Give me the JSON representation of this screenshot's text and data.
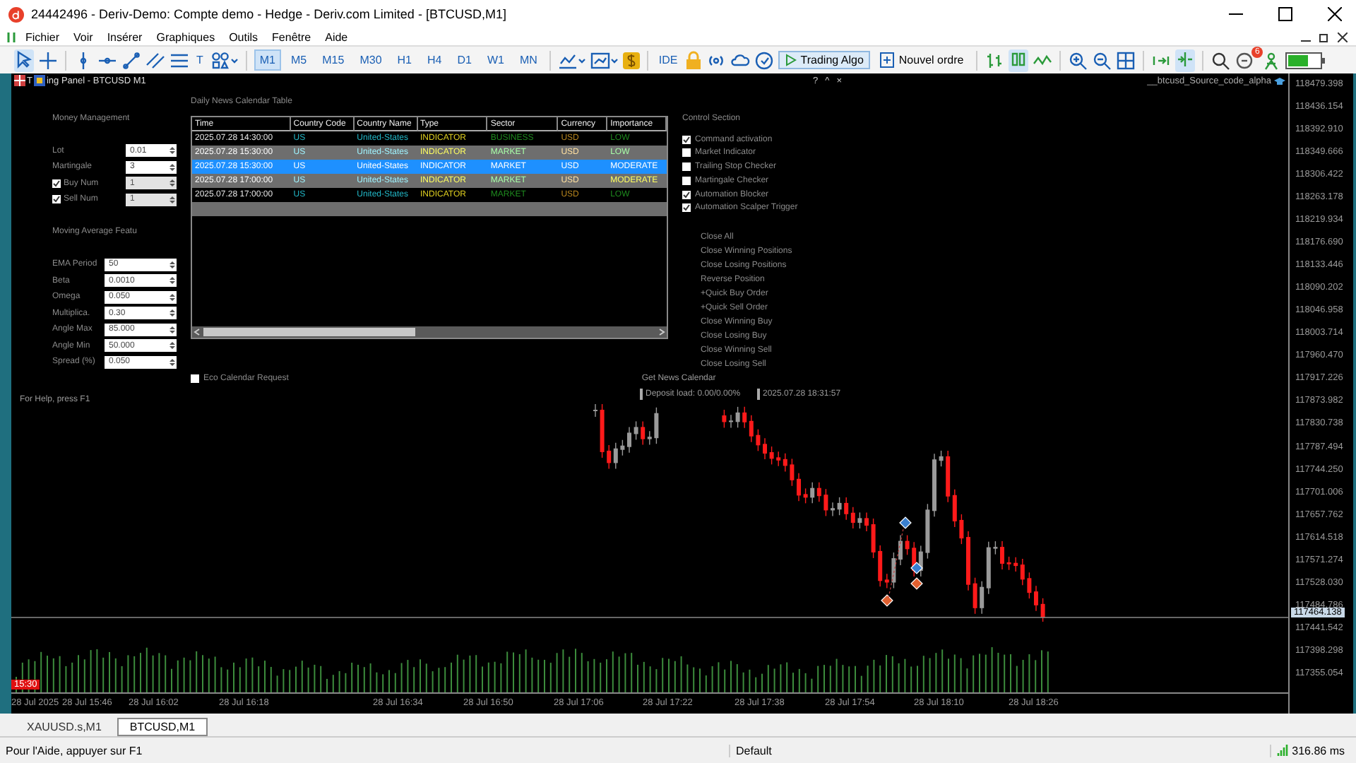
{
  "window": {
    "title": "24442496 - Deriv-Demo: Compte demo - Hedge - Deriv.com Limited - [BTCUSD,M1]"
  },
  "menu": [
    "Fichier",
    "Voir",
    "Insérer",
    "Graphiques",
    "Outils",
    "Fenêtre",
    "Aide"
  ],
  "toolbar": {
    "text_tool": "T",
    "timeframes": [
      {
        "label": "M1",
        "selected": true
      },
      {
        "label": "M5",
        "selected": false
      },
      {
        "label": "M15",
        "selected": false
      },
      {
        "label": "M30",
        "selected": false
      },
      {
        "label": "H1",
        "selected": false
      },
      {
        "label": "H4",
        "selected": false
      },
      {
        "label": "D1",
        "selected": false
      },
      {
        "label": "W1",
        "selected": false
      },
      {
        "label": "MN",
        "selected": false
      }
    ],
    "ide": "IDE",
    "trading_algo": {
      "label": "Trading Algo",
      "on": true
    },
    "new_order": "Nouvel ordre",
    "notification_count": "6"
  },
  "chart": {
    "panel_title_prefix": "T",
    "panel_title": "ing Panel - BTCUSD M1",
    "panel_controls": [
      "?",
      "^",
      "×"
    ],
    "expert_label": "__btcusd_Source_code_alpha",
    "money_management": {
      "heading": "Money Management",
      "fields": [
        {
          "kind": "plain",
          "label": "Lot",
          "value": "0.01",
          "disabled": false
        },
        {
          "kind": "plain",
          "label": "Martingale",
          "value": "3",
          "disabled": false
        },
        {
          "kind": "check",
          "label": "Buy Num",
          "checked": true,
          "value": "1",
          "disabled": true
        },
        {
          "kind": "check",
          "label": "Sell Num",
          "checked": true,
          "value": "1",
          "disabled": true
        }
      ]
    },
    "moving_average": {
      "heading": "Moving Average Featu",
      "fields": [
        {
          "label": "EMA Period",
          "value": "50"
        },
        {
          "label": "Beta",
          "value": "0.0010"
        },
        {
          "label": "Omega",
          "value": "0.050"
        },
        {
          "label": "Multiplica.",
          "value": "0.30"
        },
        {
          "label": "Angle Max",
          "value": "85.000"
        },
        {
          "label": "Angle Min",
          "value": "50.000"
        },
        {
          "label": "Spread (%)",
          "value": "0.050"
        }
      ]
    },
    "calendar": {
      "heading": "Daily News Calendar Table",
      "columns": [
        "Time",
        "Country Code",
        "Country Name",
        "Type",
        "Sector",
        "Currency",
        "Importance"
      ],
      "rows": [
        {
          "cells": [
            "2025.07.28 14:30:00",
            "US",
            "United-States",
            "INDICATOR",
            "BUSINESS",
            "USD",
            "LOW"
          ],
          "kind": "low",
          "selected": false,
          "highlighted": false
        },
        {
          "cells": [
            "2025.07.28 15:30:00",
            "US",
            "United-States",
            "INDICATOR",
            "MARKET",
            "USD",
            "LOW"
          ],
          "kind": "low",
          "selected": false,
          "highlighted": true
        },
        {
          "cells": [
            "2025.07.28 15:30:00",
            "US",
            "United-States",
            "INDICATOR",
            "MARKET",
            "USD",
            "MODERATE"
          ],
          "kind": "moderate",
          "selected": true,
          "highlighted": false
        },
        {
          "cells": [
            "2025.07.28 17:00:00",
            "US",
            "United-States",
            "INDICATOR",
            "MARKET",
            "USD",
            "MODERATE"
          ],
          "kind": "moderate",
          "selected": false,
          "highlighted": true
        },
        {
          "cells": [
            "2025.07.28 17:00:00",
            "US",
            "United-States",
            "INDICATOR",
            "MARKET",
            "USD",
            "LOW"
          ],
          "kind": "low",
          "selected": false,
          "highlighted": false
        }
      ]
    },
    "control_section": {
      "heading": "Control Section",
      "checkboxes": [
        {
          "label": "Command activation",
          "checked": true
        },
        {
          "label": "Market Indicator",
          "checked": false
        },
        {
          "label": "Trailing Stop Checker",
          "checked": false
        },
        {
          "label": "Martingale Checker",
          "checked": false
        },
        {
          "label": "Automation Blocker",
          "checked": true
        },
        {
          "label": "Automation Scalper Trigger",
          "checked": true
        }
      ],
      "buttons": [
        "Close All",
        "Close Winning Positions",
        "Close Losing Positions",
        "Reverse Position",
        "+Quick Buy Order",
        "+Quick Sell Order",
        "Close Winning Buy",
        "Close Losing Buy",
        "Close Winning Sell",
        "Close Losing Sell"
      ]
    },
    "eco_calendar": {
      "label": "Eco Calendar Request",
      "checked": false
    },
    "news_button": "Get News Calendar",
    "help_text": "For Help, press F1",
    "deposit_load": "Deposit load: 0.00/0.00%",
    "server_time": "2025.07.28 18:31:57",
    "session_badge": "15:30",
    "price_labels": [
      "118479.398",
      "118436.154",
      "118392.910",
      "118349.666",
      "118306.422",
      "118263.178",
      "118219.934",
      "118176.690",
      "118133.446",
      "118090.202",
      "118046.958",
      "118003.714",
      "117960.470",
      "117917.226",
      "117873.982",
      "117830.738",
      "117787.494",
      "117744.250",
      "117701.006",
      "117657.762",
      "117614.518",
      "117571.274",
      "117528.030",
      "117484.786",
      "117441.542",
      "117398.298",
      "117355.054"
    ],
    "current_price": "117464.138",
    "time_labels": [
      "28 Jul 2025",
      "28 Jul 15:46",
      "28 Jul 16:02",
      "28 Jul 16:18",
      "28 Jul 16:34",
      "28 Jul 16:50",
      "28 Jul 17:06",
      "28 Jul 17:22",
      "28 Jul 17:38",
      "28 Jul 17:54",
      "28 Jul 18:10",
      "28 Jul 18:26"
    ]
  },
  "chart_tabs": [
    {
      "label": "XAUUSD.s,M1",
      "selected": false
    },
    {
      "label": "BTCUSD,M1",
      "selected": true
    }
  ],
  "status_bar": {
    "help": "Pour l'Aide, appuyer sur F1",
    "profile": "Default",
    "ping": "316.86 ms"
  }
}
